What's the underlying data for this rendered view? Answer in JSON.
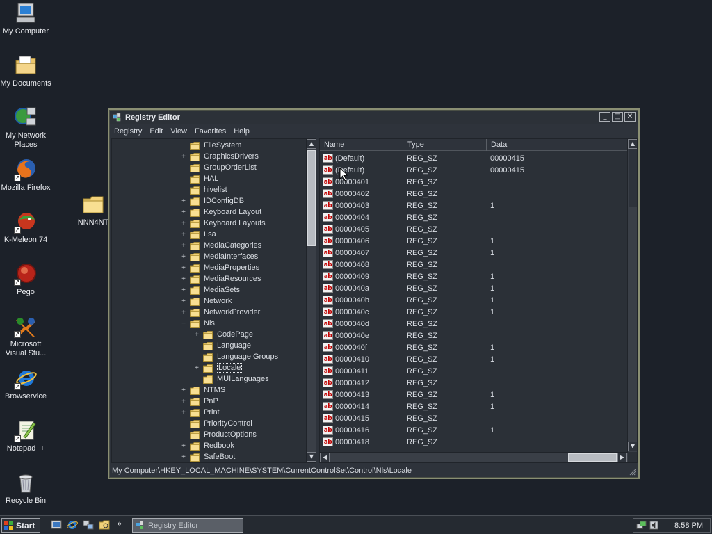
{
  "desktop": {
    "icons": [
      {
        "label": "My Computer"
      },
      {
        "label": "My Documents"
      },
      {
        "label": "My Network Places"
      },
      {
        "label": "Mozilla Firefox"
      },
      {
        "label": "K-Meleon 74"
      },
      {
        "label": "Pego"
      },
      {
        "label": "Microsoft Visual Stu..."
      },
      {
        "label": "Browservice"
      },
      {
        "label": "Notepad++"
      },
      {
        "label": "Recycle Bin"
      },
      {
        "label": "NNN4NT"
      }
    ]
  },
  "window": {
    "title": "Registry Editor",
    "buttons": {
      "minimize": "_",
      "maximize": "□",
      "close": "✕"
    },
    "menu": [
      "Registry",
      "Edit",
      "View",
      "Favorites",
      "Help"
    ],
    "tree": [
      {
        "label": "FileSystem",
        "expander": "",
        "level": 0
      },
      {
        "label": "GraphicsDrivers",
        "expander": "+",
        "level": 0
      },
      {
        "label": "GroupOrderList",
        "expander": "",
        "level": 0
      },
      {
        "label": "HAL",
        "expander": "",
        "level": 0
      },
      {
        "label": "hivelist",
        "expander": "",
        "level": 0
      },
      {
        "label": "IDConfigDB",
        "expander": "+",
        "level": 0
      },
      {
        "label": "Keyboard Layout",
        "expander": "+",
        "level": 0
      },
      {
        "label": "Keyboard Layouts",
        "expander": "+",
        "level": 0
      },
      {
        "label": "Lsa",
        "expander": "+",
        "level": 0
      },
      {
        "label": "MediaCategories",
        "expander": "+",
        "level": 0
      },
      {
        "label": "MediaInterfaces",
        "expander": "+",
        "level": 0
      },
      {
        "label": "MediaProperties",
        "expander": "+",
        "level": 0
      },
      {
        "label": "MediaResources",
        "expander": "+",
        "level": 0
      },
      {
        "label": "MediaSets",
        "expander": "+",
        "level": 0
      },
      {
        "label": "Network",
        "expander": "+",
        "level": 0
      },
      {
        "label": "NetworkProvider",
        "expander": "+",
        "level": 0
      },
      {
        "label": "Nls",
        "expander": "−",
        "level": 0
      },
      {
        "label": "CodePage",
        "expander": "+",
        "level": 1
      },
      {
        "label": "Language",
        "expander": "",
        "level": 1
      },
      {
        "label": "Language Groups",
        "expander": "",
        "level": 1
      },
      {
        "label": "Locale",
        "expander": "+",
        "level": 1,
        "selected": true
      },
      {
        "label": "MUILanguages",
        "expander": "",
        "level": 1
      },
      {
        "label": "NTMS",
        "expander": "+",
        "level": 0
      },
      {
        "label": "PnP",
        "expander": "+",
        "level": 0
      },
      {
        "label": "Print",
        "expander": "+",
        "level": 0
      },
      {
        "label": "PriorityControl",
        "expander": "",
        "level": 0
      },
      {
        "label": "ProductOptions",
        "expander": "",
        "level": 0
      },
      {
        "label": "Redbook",
        "expander": "+",
        "level": 0
      },
      {
        "label": "SafeBoot",
        "expander": "+",
        "level": 0
      }
    ],
    "columns": {
      "name": "Name",
      "type": "Type",
      "data": "Data"
    },
    "values": [
      {
        "name": "(Default)",
        "type": "REG_SZ",
        "data": "00000415"
      },
      {
        "name": "(Default)",
        "type": "REG_SZ",
        "data": "00000415"
      },
      {
        "name": "00000401",
        "type": "REG_SZ",
        "data": ""
      },
      {
        "name": "00000402",
        "type": "REG_SZ",
        "data": ""
      },
      {
        "name": "00000403",
        "type": "REG_SZ",
        "data": "1"
      },
      {
        "name": "00000404",
        "type": "REG_SZ",
        "data": ""
      },
      {
        "name": "00000405",
        "type": "REG_SZ",
        "data": ""
      },
      {
        "name": "00000406",
        "type": "REG_SZ",
        "data": "1"
      },
      {
        "name": "00000407",
        "type": "REG_SZ",
        "data": "1"
      },
      {
        "name": "00000408",
        "type": "REG_SZ",
        "data": ""
      },
      {
        "name": "00000409",
        "type": "REG_SZ",
        "data": "1"
      },
      {
        "name": "0000040a",
        "type": "REG_SZ",
        "data": "1"
      },
      {
        "name": "0000040b",
        "type": "REG_SZ",
        "data": "1"
      },
      {
        "name": "0000040c",
        "type": "REG_SZ",
        "data": "1"
      },
      {
        "name": "0000040d",
        "type": "REG_SZ",
        "data": ""
      },
      {
        "name": "0000040e",
        "type": "REG_SZ",
        "data": ""
      },
      {
        "name": "0000040f",
        "type": "REG_SZ",
        "data": "1"
      },
      {
        "name": "00000410",
        "type": "REG_SZ",
        "data": "1"
      },
      {
        "name": "00000411",
        "type": "REG_SZ",
        "data": ""
      },
      {
        "name": "00000412",
        "type": "REG_SZ",
        "data": ""
      },
      {
        "name": "00000413",
        "type": "REG_SZ",
        "data": "1"
      },
      {
        "name": "00000414",
        "type": "REG_SZ",
        "data": "1"
      },
      {
        "name": "00000415",
        "type": "REG_SZ",
        "data": ""
      },
      {
        "name": "00000416",
        "type": "REG_SZ",
        "data": "1"
      },
      {
        "name": "00000418",
        "type": "REG_SZ",
        "data": ""
      }
    ],
    "status_path": "My Computer\\HKEY_LOCAL_MACHINE\\SYSTEM\\CurrentControlSet\\Control\\Nls\\Locale"
  },
  "taskbar": {
    "start_label": "Start",
    "quick_launch": [
      "show-desktop-icon",
      "internet-explorer-icon",
      "network-icon",
      "explorer-icon"
    ],
    "overflow": "»",
    "task_label": "Registry Editor",
    "clock": "8:58 PM"
  },
  "colors": {
    "desktop_bg": "#1c2129",
    "window_bg": "#2e333b",
    "window_border": "#8a8f73",
    "folder": "#f4d58a",
    "text": "#d8dce2"
  }
}
